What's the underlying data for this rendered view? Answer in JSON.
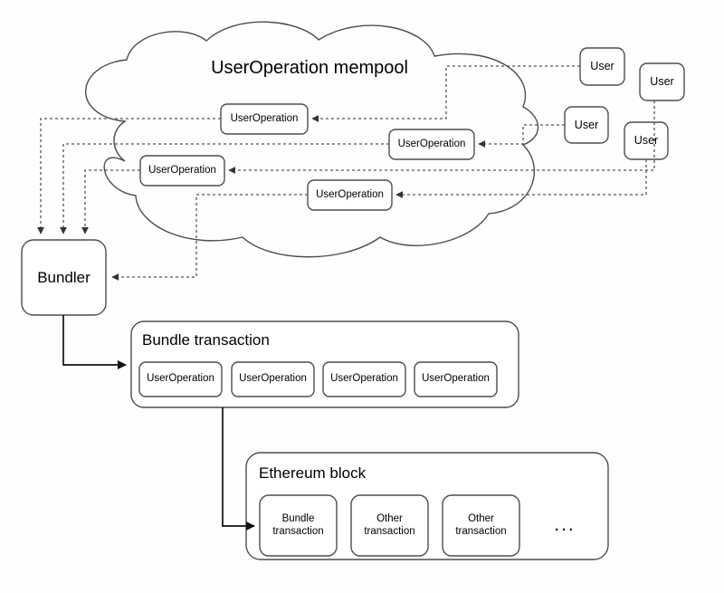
{
  "diagram": {
    "title": "UserOperation mempool",
    "background_color": "#fefefe",
    "stroke_color": "#4d4d4d",
    "node_fill": "#ffffff",
    "text_color": "#000000"
  },
  "mempool": {
    "label": "UserOperation mempool",
    "operations": [
      {
        "label": "UserOperation"
      },
      {
        "label": "UserOperation"
      },
      {
        "label": "UserOperation"
      },
      {
        "label": "UserOperation"
      }
    ]
  },
  "users": [
    {
      "label": "User"
    },
    {
      "label": "User"
    },
    {
      "label": "User"
    },
    {
      "label": "User"
    }
  ],
  "bundler": {
    "label": "Bundler"
  },
  "bundle_transaction": {
    "label": "Bundle transaction",
    "operations": [
      {
        "label": "UserOperation"
      },
      {
        "label": "UserOperation"
      },
      {
        "label": "UserOperation"
      },
      {
        "label": "UserOperation"
      }
    ]
  },
  "ethereum_block": {
    "label": "Ethereum block",
    "transactions": [
      {
        "label": "Bundle\ntransaction"
      },
      {
        "label": "Other\ntransaction"
      },
      {
        "label": "Other\ntransaction"
      }
    ],
    "ellipsis": "..."
  }
}
